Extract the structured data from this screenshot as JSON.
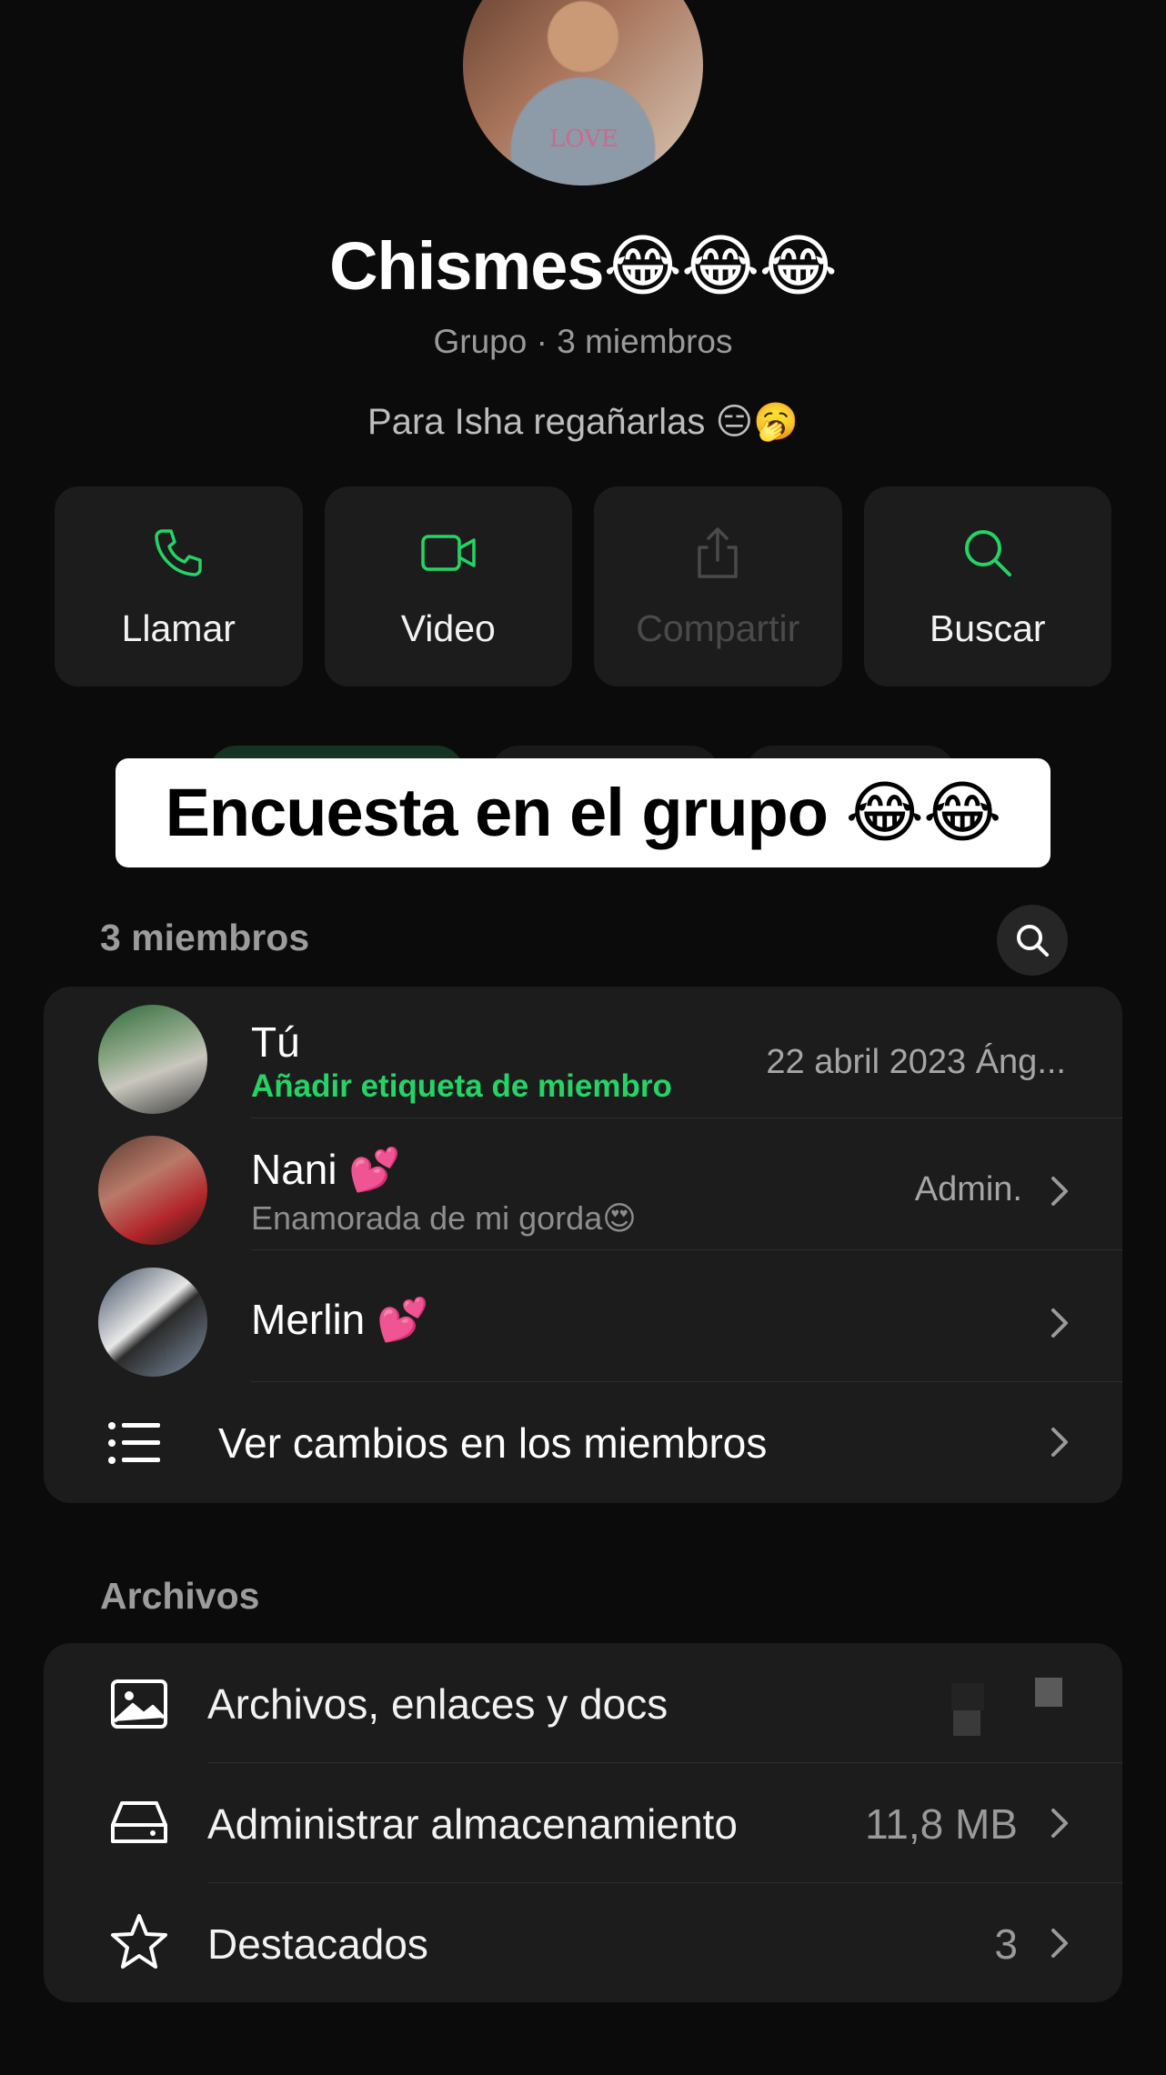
{
  "group": {
    "name": "Chismes😂😂😂",
    "subtitle": "Grupo · 3 miembros",
    "description": "Para Isha regañarlas 😑🥱"
  },
  "actions": [
    {
      "label": "Llamar",
      "icon": "phone-icon"
    },
    {
      "label": "Video",
      "icon": "video-icon"
    },
    {
      "label": "Compartir",
      "icon": "share-icon"
    },
    {
      "label": "Buscar",
      "icon": "search-icon"
    }
  ],
  "overlay": {
    "text": "Encuesta en el grupo 😂😂"
  },
  "members": {
    "header": "3 miembros",
    "items": [
      {
        "name": "Tú",
        "sub": "Añadir etiqueta de miembro",
        "right": "22 abril 2023 Áng..."
      },
      {
        "name": "Nani 💕",
        "sub": "Enamorada de mi gorda😍",
        "right": "Admin."
      },
      {
        "name": "Merlin 💕",
        "sub": "",
        "right": ""
      }
    ],
    "changes_label": "Ver cambios en los miembros"
  },
  "files": {
    "header": "Archivos",
    "items": [
      {
        "label": "Archivos, enlaces y docs",
        "value": "",
        "icon": "image-icon"
      },
      {
        "label": "Administrar almacenamiento",
        "value": "11,8 MB",
        "icon": "storage-icon"
      },
      {
        "label": "Destacados",
        "value": "3",
        "icon": "star-icon"
      }
    ]
  },
  "colors": {
    "accent": "#25d366",
    "background": "#0b0b0b",
    "card": "#1c1c1c"
  }
}
